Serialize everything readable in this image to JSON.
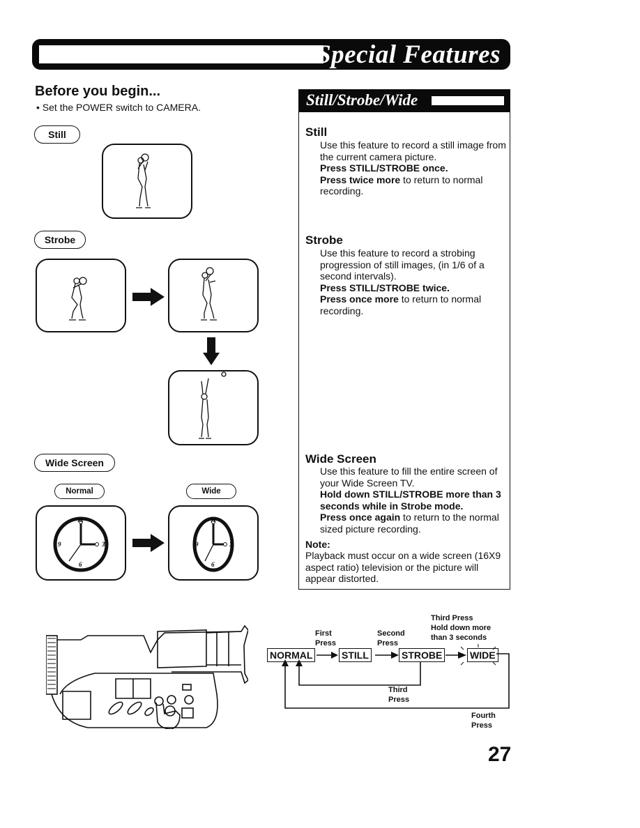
{
  "header": {
    "title": "Special Features"
  },
  "before": {
    "title": "Before you begin...",
    "bullet": "• Set the POWER switch to CAMERA."
  },
  "left": {
    "still_label": "Still",
    "strobe_label": "Strobe",
    "wide_label": "Wide Screen",
    "normal_label": "Normal",
    "wide_small_label": "Wide",
    "clock_numbers": [
      "12",
      "3",
      "6",
      "9"
    ]
  },
  "rightbox": {
    "title": "Still/Strobe/Wide",
    "still": {
      "heading": "Still",
      "line1": "Use this feature to record a still image from the current camera picture.",
      "bold1": "Press STILL/STROBE once.",
      "bold2": "Press twice more",
      "rest2": " to return to normal recording."
    },
    "strobe": {
      "heading": "Strobe",
      "line1": "Use this feature to record a strobing progression of still images, (in 1/6 of a second intervals).",
      "bold1": "Press STILL/STROBE twice.",
      "bold2": "Press once more",
      "rest2": " to return to normal recording."
    },
    "wide": {
      "heading": "Wide Screen",
      "line1": "Use this feature to fill the entire screen of your Wide Screen TV.",
      "bold1": "Hold down STILL/STROBE more than 3 seconds while in Strobe mode.",
      "bold2": "Press once again",
      "rest2": " to return to the normal sized picture recording."
    },
    "note": {
      "heading": "Note:",
      "text": "Playback must occur on a wide screen (16X9 aspect ratio) television or the picture will appear distorted."
    }
  },
  "flow": {
    "states": [
      "NORMAL",
      "STILL",
      "STROBE",
      "WIDE"
    ],
    "first": "First\nPress",
    "second": "Second\nPress",
    "third_top": "Third Press\nHold down more\nthan 3 seconds",
    "third_bottom": "Third\nPress",
    "fourth": "Fourth\nPress"
  },
  "page_number": "27"
}
